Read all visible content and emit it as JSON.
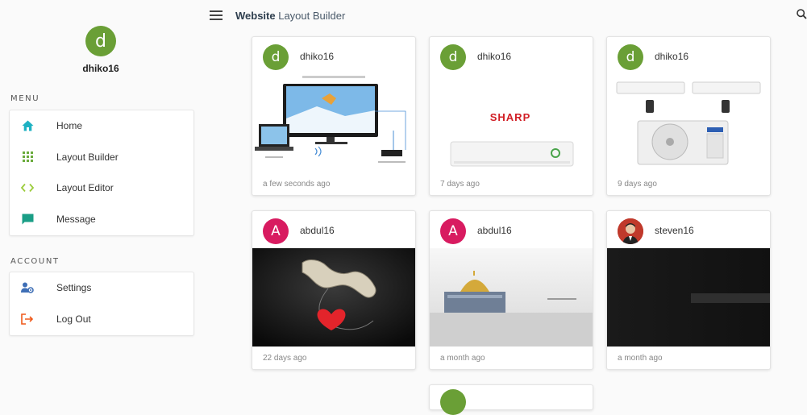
{
  "header": {
    "title_bold": "Website",
    "title_rest": " Layout Builder"
  },
  "profile": {
    "avatar_letter": "d",
    "username": "dhiko16",
    "avatar_color": "#6a9f36"
  },
  "sections": {
    "menu_label": "MENU",
    "account_label": "ACCOUNT"
  },
  "menu": [
    {
      "label": "Home",
      "icon": "home-icon",
      "color": "#1eb1c2"
    },
    {
      "label": "Layout Builder",
      "icon": "grid-icon",
      "color": "#6aab3c"
    },
    {
      "label": "Layout Editor",
      "icon": "code-icon",
      "color": "#9ccc3c"
    },
    {
      "label": "Message",
      "icon": "message-icon",
      "color": "#1a9e86"
    }
  ],
  "account": [
    {
      "label": "Settings",
      "icon": "user-settings-icon",
      "color": "#3f6fb6"
    },
    {
      "label": "Log Out",
      "icon": "logout-icon",
      "color": "#ef5a1b"
    }
  ],
  "colors": {
    "green_avatar": "#6a9f36",
    "pink_avatar": "#d81b60"
  },
  "cards": [
    {
      "user": "dhiko16",
      "avatar_letter": "d",
      "avatar_color": "#6a9f36",
      "time": "a few seconds ago",
      "image": "wireless-display-tv-image"
    },
    {
      "user": "dhiko16",
      "avatar_letter": "d",
      "avatar_color": "#6a9f36",
      "time": "7 days ago",
      "image": "sharp-air-conditioner-image",
      "brand": "SHARP"
    },
    {
      "user": "dhiko16",
      "avatar_letter": "d",
      "avatar_color": "#6a9f36",
      "time": "9 days ago",
      "image": "split-air-conditioner-image"
    },
    {
      "user": "abdul16",
      "avatar_letter": "A",
      "avatar_color": "#d81b60",
      "time": "22 days ago",
      "image": "quran-heart-image"
    },
    {
      "user": "abdul16",
      "avatar_letter": "A",
      "avatar_color": "#d81b60",
      "time": "a month ago",
      "image": "mosque-image"
    },
    {
      "user": "steven16",
      "avatar_letter": "",
      "avatar_color": "#c0392b",
      "time": "a month ago",
      "image": "dark-banner-image"
    }
  ]
}
